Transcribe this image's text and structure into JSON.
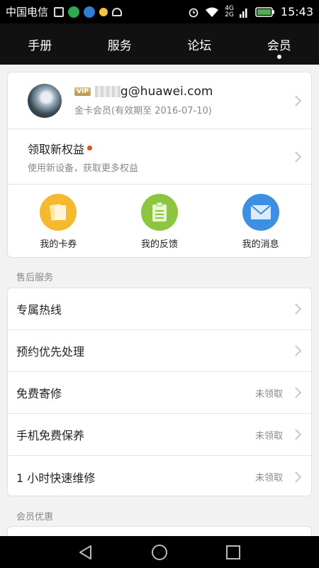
{
  "status_bar": {
    "carrier": "中国电信",
    "network_top": "4G",
    "network_bottom": "2G",
    "time": "15:43"
  },
  "header": {
    "tabs": [
      {
        "label": "手册",
        "active": false
      },
      {
        "label": "服务",
        "active": false
      },
      {
        "label": "论坛",
        "active": false
      },
      {
        "label": "会员",
        "active": true
      }
    ]
  },
  "profile": {
    "vip_badge": "VIP",
    "email_suffix": "g@huawei.com",
    "membership": "金卡会员(有效期至 2016-07-10)"
  },
  "benefit": {
    "title": "领取新权益",
    "subtitle": "使用新设备，获取更多权益"
  },
  "quick_actions": [
    {
      "label": "我的卡券",
      "icon": "card-coupon-icon",
      "color": "#f5b82e"
    },
    {
      "label": "我的反馈",
      "icon": "feedback-clipboard-icon",
      "color": "#8cc53f"
    },
    {
      "label": "我的消息",
      "icon": "envelope-icon",
      "color": "#3c8fe3"
    }
  ],
  "after_sales": {
    "section_title": "售后服务",
    "items": [
      {
        "title": "专属热线",
        "status": ""
      },
      {
        "title": "预约优先处理",
        "status": ""
      },
      {
        "title": "免费寄修",
        "status": "未领取"
      },
      {
        "title": "手机免费保养",
        "status": "未领取"
      },
      {
        "title": "1 小时快速维修",
        "status": "未领取"
      }
    ]
  },
  "member_offers": {
    "section_title": "会员优惠"
  }
}
